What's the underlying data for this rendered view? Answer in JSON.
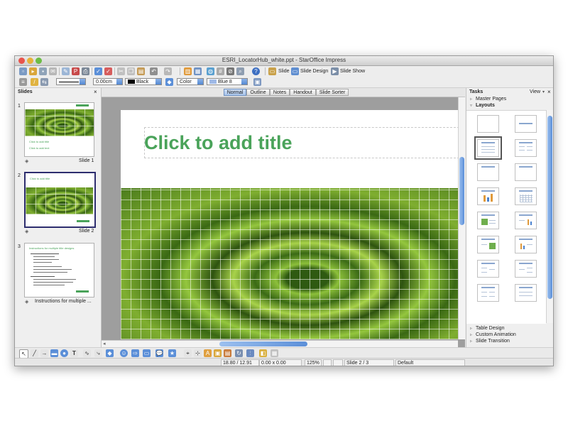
{
  "window": {
    "title": "ESRI_LocatorHub_white.ppt - StarOffice Impress"
  },
  "toolbar": {
    "slide_label": "Slide",
    "slide_design_label": "Slide Design",
    "slide_show_label": "Slide Show"
  },
  "line_bar": {
    "line_width": "0.00cm",
    "line_color": "Black",
    "area_style": "Color",
    "area_color": "Blue 8"
  },
  "slides_panel": {
    "title": "Slides",
    "close": "×",
    "slides": [
      {
        "number": "1",
        "label": "Slide 1",
        "thumb_title": "Click to add title",
        "thumb_text": "Click to add text"
      },
      {
        "number": "2",
        "label": "Slide 2",
        "thumb_title": "Click to add title"
      },
      {
        "number": "3",
        "label": "Instructions for multiple ...",
        "thumb_title": "Instructions for multiple title designs"
      }
    ]
  },
  "view_tabs": [
    "Normal",
    "Outline",
    "Notes",
    "Handout",
    "Slide Sorter"
  ],
  "slide": {
    "title_placeholder": "Click to add title"
  },
  "tasks_panel": {
    "title": "Tasks",
    "view_label": "View",
    "close": "×",
    "master_pages": "Master Pages",
    "layouts": "Layouts",
    "table_design": "Table Design",
    "custom_animation": "Custom Animation",
    "slide_transition": "Slide Transition"
  },
  "status_bar": {
    "position": "18.80 / 12.91",
    "size": "0.00 x 0.00",
    "zoom": "125%",
    "slide_indicator": "Slide 2 / 3",
    "page_style": "Default"
  },
  "colors": {
    "title_green": "#4aa35a",
    "selection_blue": "#2d2d6e",
    "accent_blue": "#5b8fd8"
  },
  "icons": [
    "new-icon",
    "open-icon",
    "save-icon",
    "print-icon",
    "spellcheck-icon",
    "cut-icon",
    "copy-icon",
    "paste-icon",
    "undo-icon",
    "redo-icon",
    "chart-icon",
    "table-icon",
    "hyperlink-icon",
    "help-icon",
    "select-icon",
    "line-icon",
    "arrow-icon",
    "rectangle-icon",
    "ellipse-icon",
    "text-icon",
    "star-icon"
  ]
}
